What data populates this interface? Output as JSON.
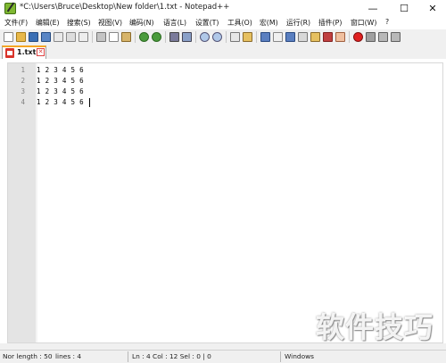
{
  "window": {
    "title": "*C:\\Users\\Bruce\\Desktop\\New folder\\1.txt - Notepad++",
    "minimize": "—",
    "maximize": "☐",
    "close": "✕"
  },
  "menu": [
    "文件(F)",
    "编辑(E)",
    "搜索(S)",
    "视图(V)",
    "编码(N)",
    "语言(L)",
    "设置(T)",
    "工具(O)",
    "宏(M)",
    "运行(R)",
    "插件(P)",
    "窗口(W)",
    "?"
  ],
  "tab": {
    "label": "1.txt",
    "close": "✕",
    "icon": "modified-file-icon"
  },
  "editor": {
    "line_numbers": [
      "1",
      "2",
      "3",
      "4"
    ],
    "lines": [
      "1 2 3 4 5 6",
      "1 2 3 4 5 6",
      "1 2 3 4 5 6",
      "1 2 3 4 5 6"
    ]
  },
  "status": {
    "length": "Nor length : 50",
    "lines": "lines : 4",
    "position": "Ln : 4    Col : 12    Sel : 0 | 0",
    "eol": "Windows"
  },
  "watermark": "软件技巧",
  "colors": {
    "accent_tab": "#f5a623",
    "gutter": "#e4e4e4",
    "chrome": "#f0f0f0"
  }
}
